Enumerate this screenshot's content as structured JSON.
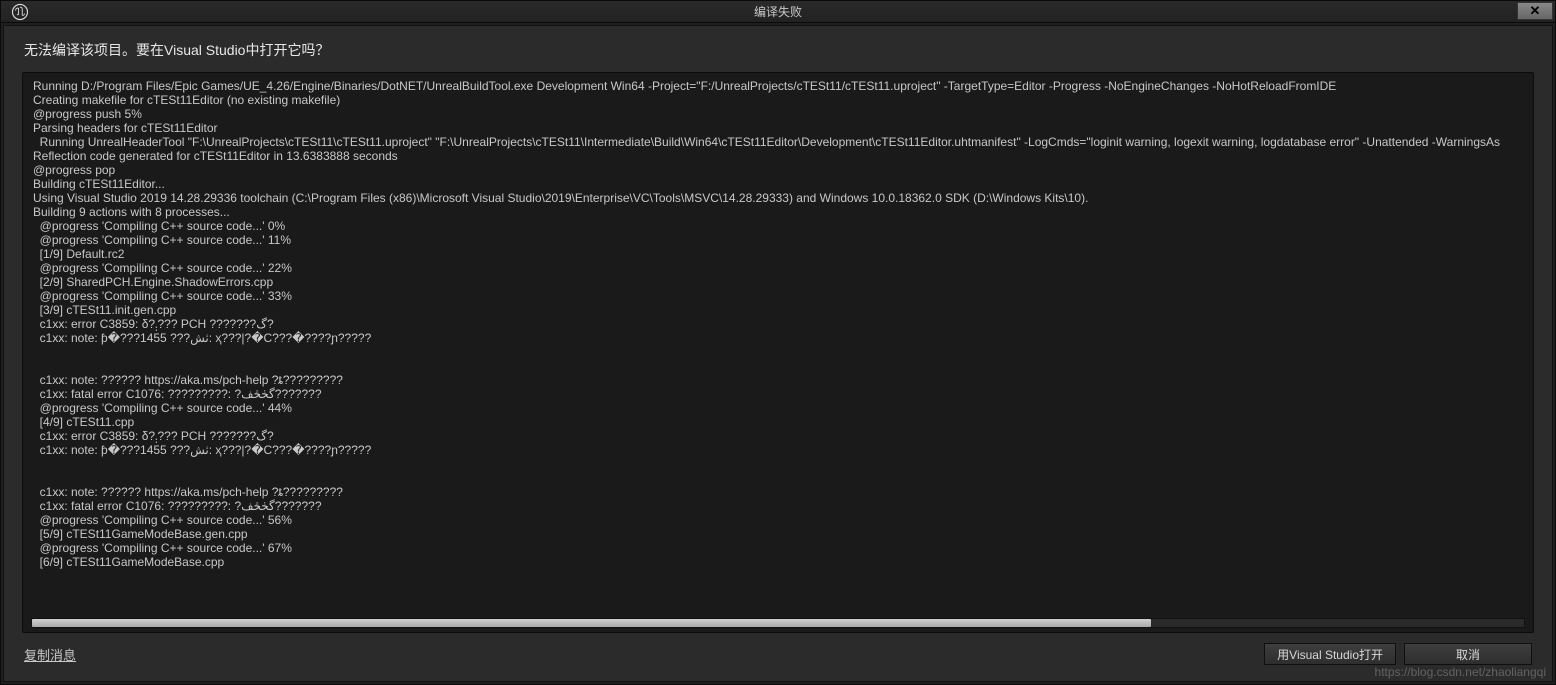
{
  "titlebar": {
    "title": "编译失败"
  },
  "prompt": "无法编译该项目。要在Visual Studio中打开它吗？",
  "log": {
    "lines": [
      "Running D:/Program Files/Epic Games/UE_4.26/Engine/Binaries/DotNET/UnrealBuildTool.exe Development Win64 -Project=\"F:/UnrealProjects/cTESt11/cTESt11.uproject\" -TargetType=Editor -Progress -NoEngineChanges -NoHotReloadFromIDE",
      "Creating makefile for cTESt11Editor (no existing makefile)",
      "@progress push 5%",
      "Parsing headers for cTESt11Editor",
      "  Running UnrealHeaderTool \"F:\\UnrealProjects\\cTESt11\\cTESt11.uproject\" \"F:\\UnrealProjects\\cTESt11\\Intermediate\\Build\\Win64\\cTESt11Editor\\Development\\cTESt11Editor.uhtmanifest\" -LogCmds=\"loginit warning, logexit warning, logdatabase error\" -Unattended -WarningsAs",
      "Reflection code generated for cTESt11Editor in 13.6383888 seconds",
      "@progress pop",
      "Building cTESt11Editor...",
      "Using Visual Studio 2019 14.28.29336 toolchain (C:\\Program Files (x86)\\Microsoft Visual Studio\\2019\\Enterprise\\VC\\Tools\\MSVC\\14.28.29333) and Windows 10.0.18362.0 SDK (D:\\Windows Kits\\10).",
      "Building 9 actions with 8 processes...",
      "  @progress 'Compiling C++ source code...' 0%",
      "  @progress 'Compiling C++ source code...' 11%",
      "  [1/9] Default.rc2",
      "  @progress 'Compiling C++ source code...' 22%",
      "  [2/9] SharedPCH.Engine.ShadowErrors.cpp",
      "  @progress 'Compiling C++ source code...' 33%",
      "  [3/9] cTESt11.init.gen.cpp",
      "  c1xx: error C3859: δ?܄??? PCH ???????گ?",
      "  c1xx: note: ƥ�???1455 ???ٺش: ҳ???|?�C???�????ɲ?????",
      "",
      "",
      "  c1xx: note: ?????? https://aka.ms/pch-help ?ȶ?????????",
      "  c1xx: fatal error C1076: ?????????: ?گڂڅف???????",
      "  @progress 'Compiling C++ source code...' 44%",
      "  [4/9] cTESt11.cpp",
      "  c1xx: error C3859: δ?܄??? PCH ???????گ?",
      "  c1xx: note: ƥ�???1455 ???ٺش: ҳ???|?�C???�????ɲ?????",
      "",
      "",
      "  c1xx: note: ?????? https://aka.ms/pch-help ?ȶ?????????",
      "  c1xx: fatal error C1076: ?????????: ?گڂڅف???????",
      "  @progress 'Compiling C++ source code...' 56%",
      "  [5/9] cTESt11GameModeBase.gen.cpp",
      "  @progress 'Compiling C++ source code...' 67%",
      "  [6/9] cTESt11GameModeBase.cpp"
    ]
  },
  "footer": {
    "copy_link": "复制消息",
    "open_button": "用Visual Studio打开",
    "cancel_button": "取消"
  },
  "watermark": "https://blog.csdn.net/zhaoliangqi"
}
